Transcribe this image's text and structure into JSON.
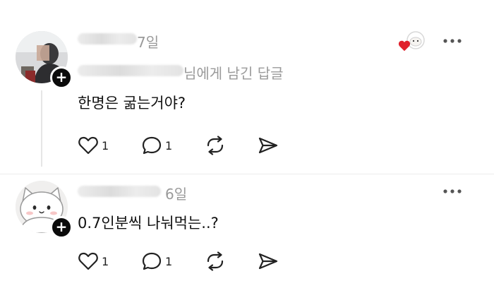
{
  "comments": [
    {
      "time": "7일",
      "reply_to_suffix": "님에게 남긴 답글",
      "body": "한명은 굶는거야?",
      "like_count": "1",
      "reply_count": "1",
      "avatar_icon": "person-photo",
      "liked_by_author": true
    },
    {
      "time": "6일",
      "body": "0.7인분씩 나눠먹는..?",
      "like_count": "1",
      "reply_count": "1",
      "avatar_icon": "white-cat-character"
    }
  ],
  "icons": {
    "like": "heart-icon",
    "reply": "speech-bubble-icon",
    "repost": "repost-icon",
    "share": "send-icon",
    "more": "more-icon",
    "follow": "plus-icon"
  },
  "colors": {
    "liked_heart": "#e0202c",
    "meta_text": "#9a9a9a",
    "badge": "#0b0b0b"
  }
}
